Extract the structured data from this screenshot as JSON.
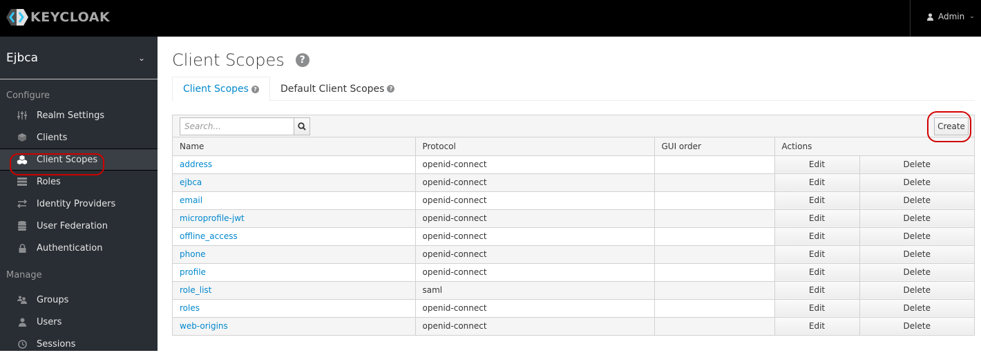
{
  "header": {
    "brand": "KEYCLOAK",
    "user_label": "Admin"
  },
  "sidebar": {
    "realm": "Ejbca",
    "configure_label": "Configure",
    "configure_items": [
      {
        "label": "Realm Settings",
        "icon": "sliders-icon"
      },
      {
        "label": "Clients",
        "icon": "cube-icon"
      },
      {
        "label": "Client Scopes",
        "icon": "cubes-icon",
        "active": true
      },
      {
        "label": "Roles",
        "icon": "server-icon"
      },
      {
        "label": "Identity Providers",
        "icon": "exchange-icon"
      },
      {
        "label": "User Federation",
        "icon": "database-icon"
      },
      {
        "label": "Authentication",
        "icon": "lock-icon"
      }
    ],
    "manage_label": "Manage",
    "manage_items": [
      {
        "label": "Groups",
        "icon": "users-icon"
      },
      {
        "label": "Users",
        "icon": "user-icon"
      },
      {
        "label": "Sessions",
        "icon": "clock-icon"
      }
    ]
  },
  "main": {
    "title": "Client Scopes",
    "tabs": [
      {
        "label": "Client Scopes",
        "active": true
      },
      {
        "label": "Default Client Scopes",
        "active": false
      }
    ],
    "search_placeholder": "Search...",
    "create_label": "Create",
    "columns": [
      "Name",
      "Protocol",
      "GUI order",
      "Actions"
    ],
    "edit_label": "Edit",
    "delete_label": "Delete",
    "rows": [
      {
        "name": "address",
        "protocol": "openid-connect",
        "gui_order": ""
      },
      {
        "name": "ejbca",
        "protocol": "openid-connect",
        "gui_order": ""
      },
      {
        "name": "email",
        "protocol": "openid-connect",
        "gui_order": ""
      },
      {
        "name": "microprofile-jwt",
        "protocol": "openid-connect",
        "gui_order": ""
      },
      {
        "name": "offline_access",
        "protocol": "openid-connect",
        "gui_order": ""
      },
      {
        "name": "phone",
        "protocol": "openid-connect",
        "gui_order": ""
      },
      {
        "name": "profile",
        "protocol": "openid-connect",
        "gui_order": ""
      },
      {
        "name": "role_list",
        "protocol": "saml",
        "gui_order": ""
      },
      {
        "name": "roles",
        "protocol": "openid-connect",
        "gui_order": ""
      },
      {
        "name": "web-origins",
        "protocol": "openid-connect",
        "gui_order": ""
      }
    ]
  },
  "colors": {
    "link": "#0088ce",
    "highlight": "#d10000",
    "sidebar_bg": "#292e34"
  }
}
